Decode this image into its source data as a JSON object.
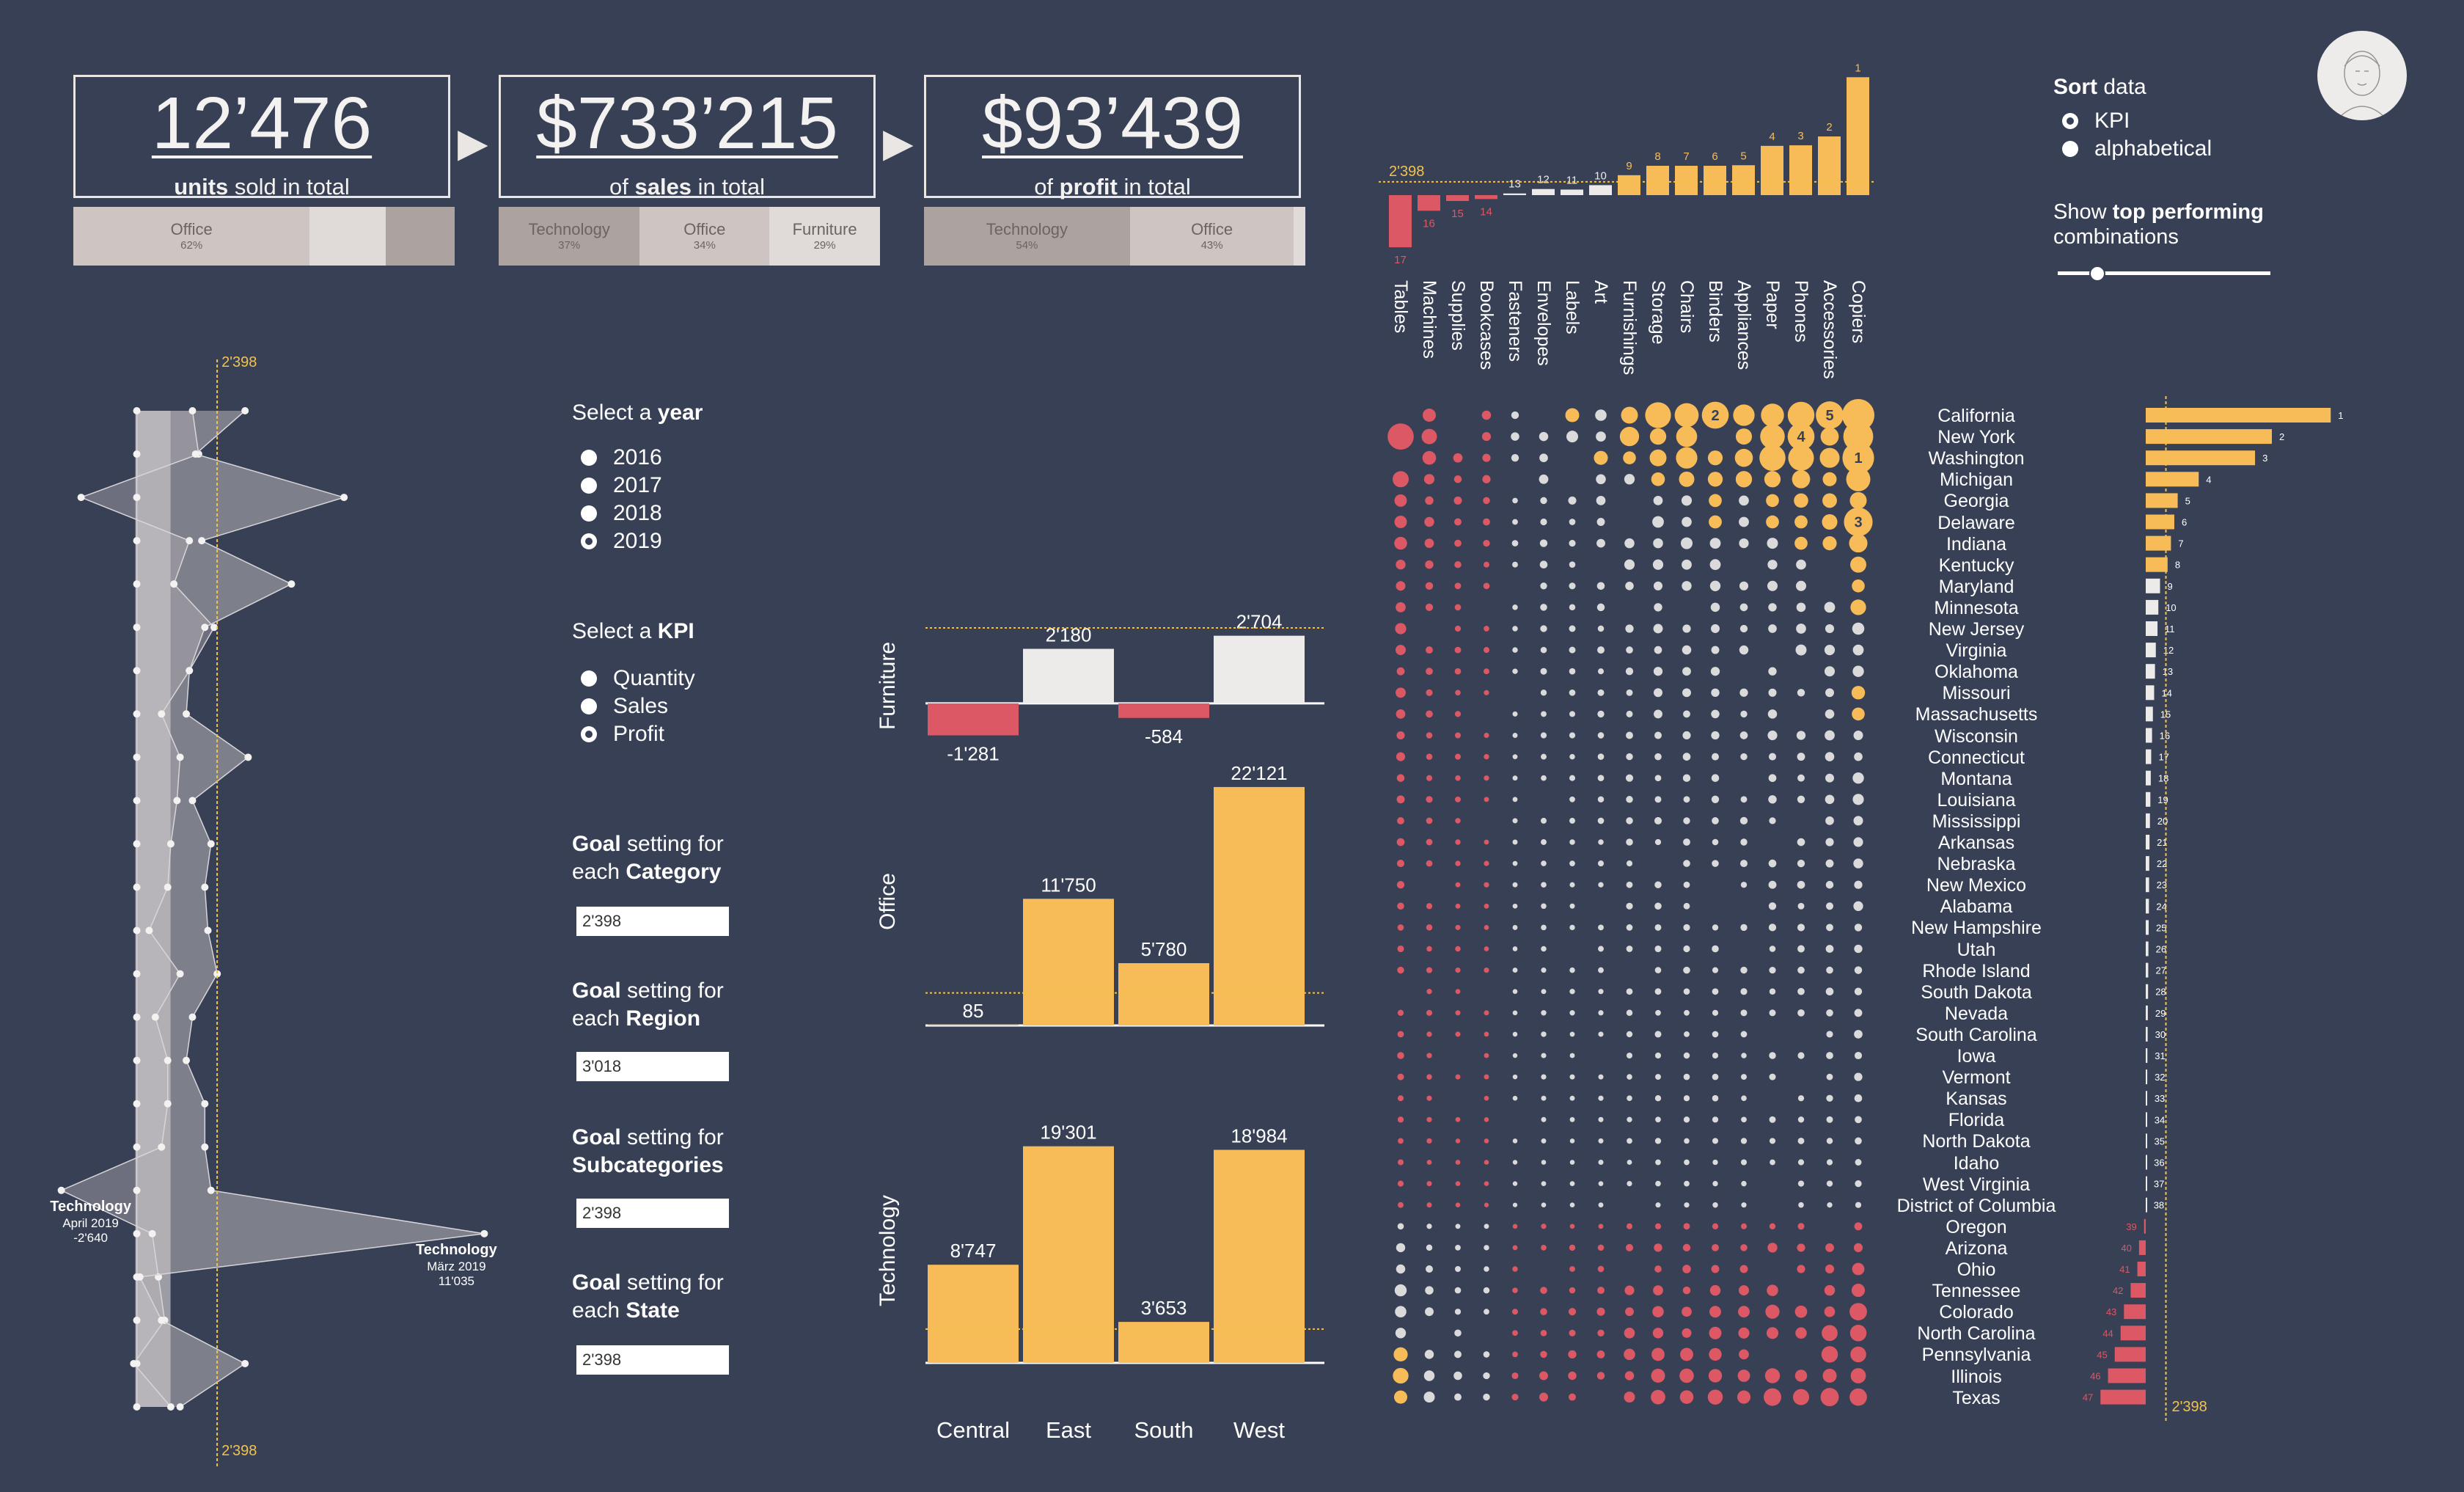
{
  "kpis": [
    {
      "value": "12’476",
      "caption_bold": "units",
      "caption_rest": " sold in total"
    },
    {
      "value": "$733’215",
      "caption_pre": "of ",
      "caption_bold": "sales",
      "caption_rest": " in total"
    },
    {
      "value": "$93’439",
      "caption_pre": "of ",
      "caption_bold": "profit",
      "caption_rest": " in total"
    }
  ],
  "shares": [
    {
      "segments": [
        {
          "name": "Office",
          "pct": "62%",
          "value": 62,
          "color": "#cec5c2"
        },
        {
          "name": "",
          "pct": "",
          "value": 20,
          "color": "#e0dad8"
        },
        {
          "name": "",
          "pct": "",
          "value": 18,
          "color": "#aca3a1"
        }
      ]
    },
    {
      "segments": [
        {
          "name": "Technology",
          "pct": "37%",
          "value": 37,
          "color": "#aca3a1"
        },
        {
          "name": "Office",
          "pct": "34%",
          "value": 34,
          "color": "#cec5c2"
        },
        {
          "name": "Furniture",
          "pct": "29%",
          "value": 29,
          "color": "#e0dad8"
        }
      ]
    },
    {
      "segments": [
        {
          "name": "Technology",
          "pct": "54%",
          "value": 54,
          "color": "#aca3a1"
        },
        {
          "name": "Office",
          "pct": "43%",
          "value": 43,
          "color": "#cec5c2"
        },
        {
          "name": "",
          "pct": "",
          "value": 3,
          "color": "#e0dad8"
        }
      ]
    }
  ],
  "controls": {
    "year_title_pre": "Select a ",
    "year_title_bold": "year",
    "years": [
      "2016",
      "2017",
      "2018",
      "2019"
    ],
    "year_selected": "2019",
    "kpi_title_pre": "Select a ",
    "kpi_title_bold": "KPI",
    "kpis": [
      "Quantity",
      "Sales",
      "Profit"
    ],
    "kpi_selected": "Profit",
    "goals": [
      {
        "bold": "Goal",
        "line1_rest": " setting for",
        "line2_pre": "each ",
        "line2_bold": "Category",
        "value": "2'398"
      },
      {
        "bold": "Goal",
        "line1_rest": " setting for",
        "line2_pre": "each ",
        "line2_bold": "Region",
        "value": "3'018"
      },
      {
        "bold": "Goal",
        "line1_rest": " setting for",
        "line2_pre": "",
        "line2_bold": "Subcategories",
        "value": "2'398"
      },
      {
        "bold": "Goal",
        "line1_rest": " setting for",
        "line2_pre": "each ",
        "line2_bold": "State",
        "value": "2'398"
      }
    ],
    "sort_title_bold": "Sort",
    "sort_title_rest": " data",
    "sort_options": [
      "KPI",
      "alphabetical"
    ],
    "sort_selected": "KPI",
    "show_bold": "top performing",
    "show_pre": "Show ",
    "show_line2": "combinations",
    "top_combinations": 0.18
  },
  "chart_data": [
    {
      "type": "line",
      "name": "monthly-profit-by-category",
      "goal": 2398,
      "goal_label": "2'398",
      "xlim": [
        -3200,
        11500
      ],
      "points_per_month": 24,
      "series": [
        {
          "values": [
            -200,
            -200,
            -200,
            -200,
            -200,
            -200,
            -200,
            -200,
            -200,
            -200,
            -200,
            -200,
            -200,
            -200,
            -200,
            -200,
            -200,
            -200,
            -200,
            -200,
            -200,
            -200,
            -200,
            -200
          ]
        },
        {
          "values": [
            1600,
            1800,
            -2000,
            1500,
            1000,
            2300,
            1500,
            600,
            1200,
            1100,
            900,
            800,
            200,
            1200,
            400,
            800,
            800,
            600,
            -2640,
            300,
            500,
            700,
            -300,
            900
          ]
        },
        {
          "values": [
            3300,
            1700,
            6500,
            1900,
            4800,
            2000,
            1500,
            1400,
            3400,
            1600,
            2200,
            2000,
            2100,
            2400,
            1600,
            1400,
            2000,
            2000,
            2200,
            11035,
            -100,
            600,
            3300,
            1200
          ]
        }
      ],
      "annotations": [
        {
          "title": "Technology",
          "sub1": "April 2019",
          "sub2": "-2'640"
        },
        {
          "title": "Technology",
          "sub1": "März 2019",
          "sub2": "11'035"
        }
      ]
    },
    {
      "type": "bar",
      "name": "profit-by-category-and-region",
      "categories": [
        "Central",
        "East",
        "South",
        "West"
      ],
      "goal": 3018,
      "panels": [
        {
          "label": "Furniture",
          "values": [
            -1281,
            2180,
            -584,
            2704
          ],
          "value_labels": [
            "-1'281",
            "2'180",
            "-584",
            "2'704"
          ],
          "ylim": [
            -1500,
            2900
          ]
        },
        {
          "label": "Office",
          "values": [
            85,
            11750,
            5780,
            22121
          ],
          "value_labels": [
            "85",
            "11'750",
            "5'780",
            "22'121"
          ],
          "ylim": [
            0,
            23000
          ]
        },
        {
          "label": "Technology",
          "values": [
            8747,
            19301,
            3653,
            18984
          ],
          "value_labels": [
            "8'747",
            "19'301",
            "3'653",
            "18'984"
          ],
          "ylim": [
            0,
            20000
          ]
        }
      ]
    },
    {
      "type": "bar",
      "name": "profit-by-subcategory",
      "goal": 2398,
      "goal_label": "2'398",
      "categories": [
        "Tables",
        "Machines",
        "Supplies",
        "Bookcases",
        "Fasteners",
        "Envelopes",
        "Labels",
        "Art",
        "Furnishings",
        "Storage",
        "Chairs",
        "Binders",
        "Appliances",
        "Paper",
        "Phones",
        "Accessories",
        "Copiers"
      ],
      "values": [
        -8000,
        -2400,
        -900,
        -600,
        300,
        1100,
        1000,
        1800,
        3600,
        5300,
        5300,
        5300,
        5400,
        8900,
        9000,
        10600,
        21300
      ],
      "ranks": [
        "17",
        "16",
        "15",
        "14",
        "13",
        "12",
        "11",
        "10",
        "9",
        "8",
        "7",
        "6",
        "5",
        "4",
        "3",
        "2",
        "1"
      ],
      "ylim": [
        -9000,
        22000
      ]
    },
    {
      "type": "bar",
      "name": "profit-by-state",
      "goal": 2398,
      "goal_label": "2'398",
      "states": [
        "California",
        "New York",
        "Washington",
        "Michigan",
        "Georgia",
        "Delaware",
        "Indiana",
        "Kentucky",
        "Maryland",
        "Minnesota",
        "New Jersey",
        "Virginia",
        "Oklahoma",
        "Missouri",
        "Massachusetts",
        "Wisconsin",
        "Connecticut",
        "Montana",
        "Louisiana",
        "Mississippi",
        "Arkansas",
        "Nebraska",
        "New Mexico",
        "Alabama",
        "New Hampshire",
        "Utah",
        "Rhode Island",
        "South Dakota",
        "Nevada",
        "South Carolina",
        "Iowa",
        "Vermont",
        "Kansas",
        "Florida",
        "North Dakota",
        "Idaho",
        "West Virginia",
        "District of Columbia",
        "Oregon",
        "Arizona",
        "Ohio",
        "Tennessee",
        "Colorado",
        "North Carolina",
        "Pennsylvania",
        "Illinois",
        "Texas"
      ],
      "values": [
        22000,
        15000,
        13000,
        6300,
        3800,
        3400,
        3000,
        2600,
        1700,
        1500,
        1400,
        1200,
        1100,
        1000,
        850,
        750,
        650,
        600,
        550,
        500,
        450,
        420,
        400,
        380,
        350,
        320,
        300,
        280,
        250,
        230,
        200,
        180,
        160,
        150,
        130,
        100,
        80,
        60,
        -200,
        -800,
        -1000,
        -1800,
        -2600,
        -3000,
        -3700,
        -4500,
        -5400
      ],
      "ranks": [
        "1",
        "2",
        "3",
        "4",
        "5",
        "6",
        "7",
        "8",
        "9",
        "10",
        "11",
        "12",
        "13",
        "14",
        "15",
        "16",
        "17",
        "18",
        "19",
        "20",
        "21",
        "22",
        "23",
        "24",
        "25",
        "26",
        "27",
        "28",
        "29",
        "30",
        "31",
        "32",
        "33",
        "34",
        "35",
        "36",
        "37",
        "38",
        "39",
        "40",
        "41",
        "42",
        "43",
        "44",
        "45",
        "46",
        "47"
      ],
      "xlim": [
        -7000,
        22500
      ]
    },
    {
      "type": "scatter",
      "name": "state-by-subcategory-matrix",
      "description_rows": "states",
      "description_cols": "subcategories",
      "rows": 47,
      "cols": 17,
      "big_dots": [
        {
          "row": 0,
          "col": 11,
          "v": 3000,
          "rank": "2"
        },
        {
          "row": 0,
          "col": 15,
          "v": 3200,
          "rank": "5"
        },
        {
          "row": 1,
          "col": 14,
          "v": 3000,
          "rank": "4"
        },
        {
          "row": 2,
          "col": 16,
          "v": 4400,
          "rank": "1"
        },
        {
          "row": 5,
          "col": 16,
          "v": 3500,
          "rank": "3"
        }
      ]
    }
  ]
}
